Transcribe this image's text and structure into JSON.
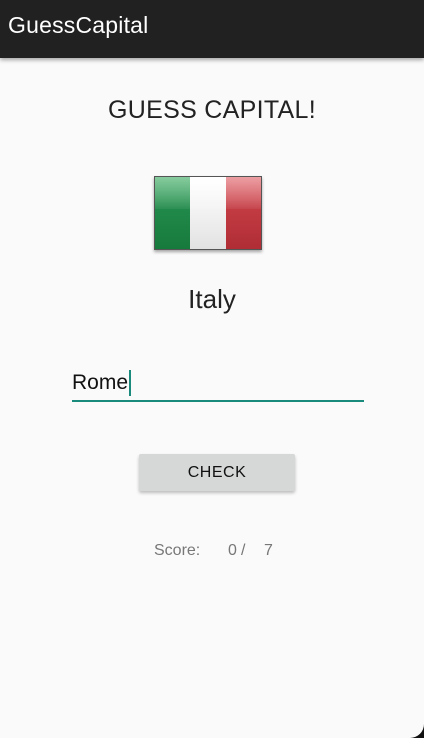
{
  "app_bar": {
    "title": "GuessCapital"
  },
  "main": {
    "heading": "GUESS CAPITAL!",
    "country": "Italy",
    "flag": {
      "icon": "italy-flag-icon",
      "colors": [
        "#1e8a4a",
        "#f3f3f3",
        "#c23b43"
      ]
    },
    "answer_input": {
      "value": "Rome"
    },
    "check_button_label": "CHECK",
    "score": {
      "label": "Score:",
      "current": "0",
      "separator": "/",
      "total": "7"
    }
  },
  "colors": {
    "app_bar": "#212121",
    "accent": "#1a8a7d",
    "button": "#d6d7d7",
    "background": "#fafafa"
  }
}
